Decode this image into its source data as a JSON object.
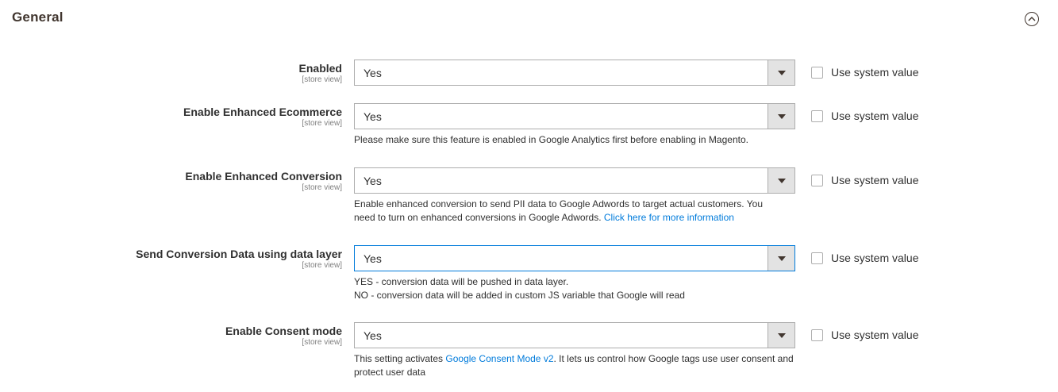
{
  "section": {
    "title": "General"
  },
  "system_value_label": "Use system value",
  "rows": [
    {
      "label": "Enabled",
      "scope": "[store view]",
      "value": "Yes"
    },
    {
      "label": "Enable Enhanced Ecommerce",
      "scope": "[store view]",
      "value": "Yes",
      "note": "Please make sure this feature is enabled in Google Analytics first before enabling in Magento."
    },
    {
      "label": "Enable Enhanced Conversion",
      "scope": "[store view]",
      "value": "Yes",
      "note_text": "Enable enhanced conversion to send PII data to Google Adwords to target actual customers. You need to turn on enhanced conversions in Google Adwords.",
      "note_link": "Click here for more information"
    },
    {
      "label": "Send Conversion Data using data layer",
      "scope": "[store view]",
      "value": "Yes",
      "note_line1": "YES - conversion data will be pushed in data layer.",
      "note_line2": "NO - conversion data will be added in custom JS variable that Google will read"
    },
    {
      "label": "Enable Consent mode",
      "scope": "[store view]",
      "value": "Yes",
      "note_before": "This setting activates",
      "note_link": "Google Consent Mode v2",
      "note_after": ". It lets us control how Google tags use user consent and protect user data"
    }
  ]
}
